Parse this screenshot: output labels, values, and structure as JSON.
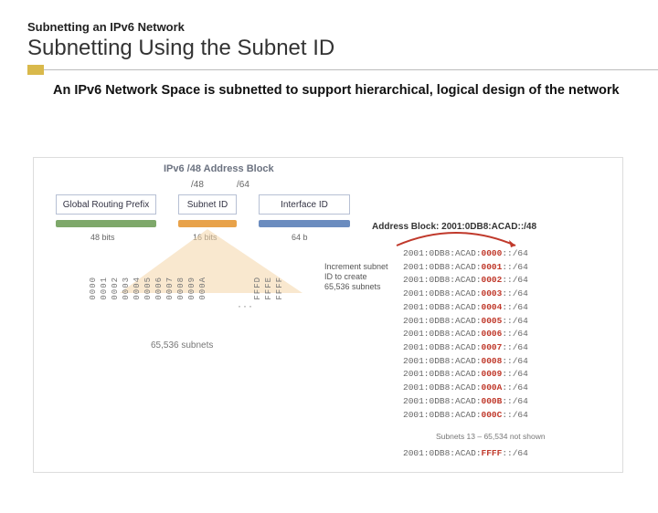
{
  "supertitle": "Subnetting an IPv6 Network",
  "title": "Subnetting Using the Subnet ID",
  "body": "An IPv6 Network Space is subnetted to support hierarchical, logical design of the network",
  "diagram": {
    "heading": "IPv6 /48 Address Block",
    "prefix48": "/48",
    "prefix64": "/64",
    "global_routing_prefix": "Global Routing Prefix",
    "subnet_id": "Subnet ID",
    "interface_id": "Interface ID",
    "bits48": "48 bits",
    "bits16": "16 bits",
    "bits64": "64 b",
    "subnets_label": "65,536 subnets",
    "hex_ids": [
      "0000",
      "0001",
      "0002",
      "0003",
      "0004",
      "0005",
      "0006",
      "0007",
      "0008",
      "0009",
      "000A"
    ],
    "hex_tail": [
      "FFFD",
      "FFFE",
      "FFFF"
    ],
    "address_block_label": "Address Block: 2001:0DB8:ACAD::/48",
    "increment_text": "Increment subnet ID to create 65,536 subnets",
    "addr_prefix": "2001:0DB8:ACAD:",
    "cidr": "::/64",
    "subnets": [
      "0000",
      "0001",
      "0002",
      "0003",
      "0004",
      "0005",
      "0006",
      "0007",
      "0008",
      "0009",
      "000A",
      "000B",
      "000C"
    ],
    "gap_note": "Subnets 13 – 65,534 not shown",
    "last_subnet": "FFFF"
  }
}
